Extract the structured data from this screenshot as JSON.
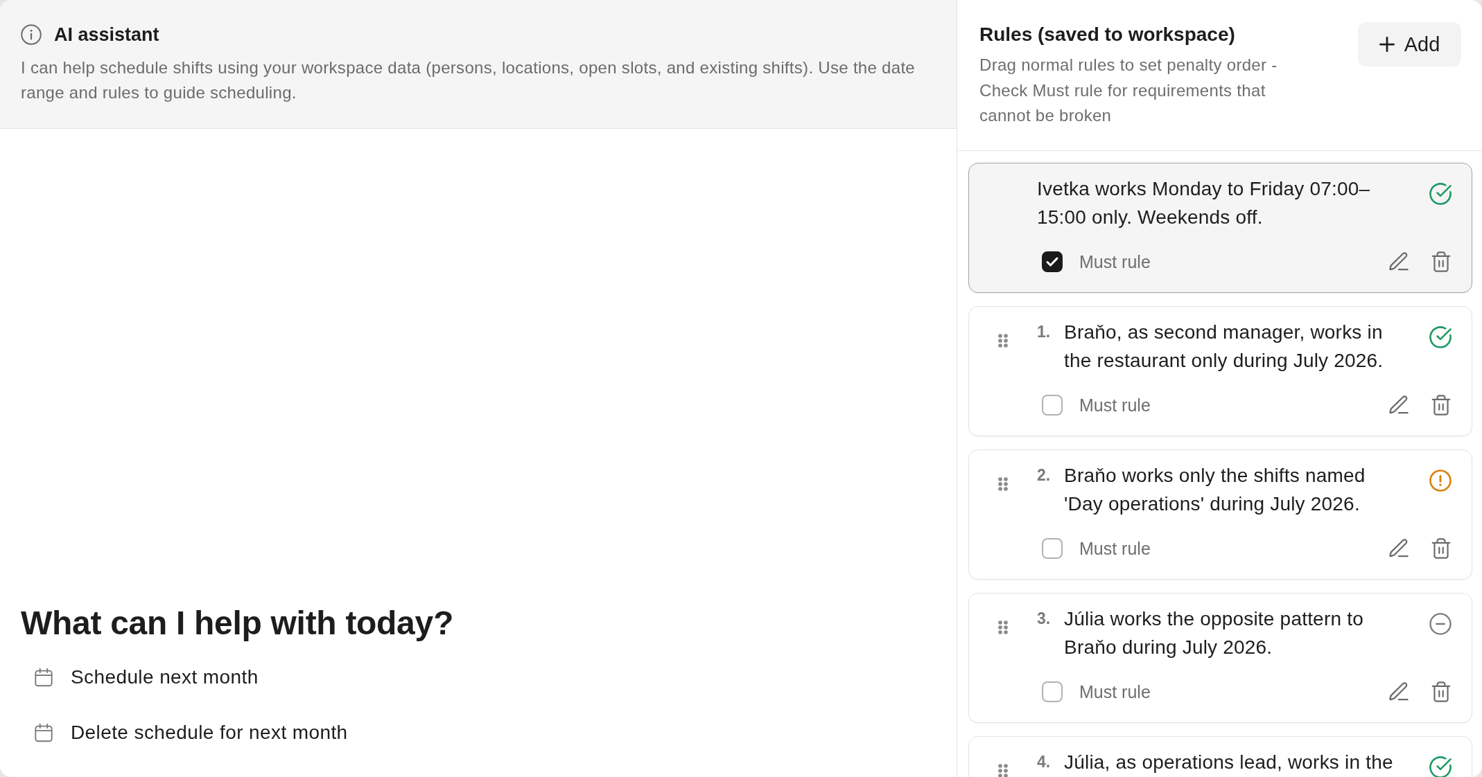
{
  "assistant": {
    "title": "AI assistant",
    "description": "I can help schedule shifts using your workspace data (persons, locations, open slots, and existing shifts). Use the date range and rules to guide scheduling."
  },
  "welcome": {
    "heading": "What can I help with today?",
    "suggestions": [
      {
        "label": "Schedule next month"
      },
      {
        "label": "Delete schedule for next month"
      }
    ]
  },
  "rules_panel": {
    "title": "Rules (saved to workspace)",
    "description": "Drag normal rules to set penalty order - Check Must rule for requirements that cannot be broken",
    "add_button": "Add",
    "rules": [
      {
        "kind": "must",
        "text": "Ivetka works Monday to Friday 07:00–15:00 only. Weekends off.",
        "status": {
          "kind": "check",
          "color": "#1f9a67"
        },
        "must_rule": {
          "label": "Must rule",
          "checked": true
        }
      },
      {
        "kind": "normal",
        "number": "1.",
        "text": "Braňo, as second manager, works in the restaurant only during July 2026.",
        "status": {
          "kind": "check",
          "color": "#1f9a67"
        },
        "must_rule": {
          "label": "Must rule",
          "checked": false
        }
      },
      {
        "kind": "normal",
        "number": "2.",
        "text": "Braňo works only the shifts named 'Day operations' during July 2026.",
        "status": {
          "kind": "exclamation",
          "color": "#d9820f"
        },
        "must_rule": {
          "label": "Must rule",
          "checked": false
        }
      },
      {
        "kind": "normal",
        "number": "3.",
        "text": "Júlia works the opposite pattern to Braňo during July 2026.",
        "status": {
          "kind": "minus",
          "color": "#7a7a7a"
        },
        "must_rule": {
          "label": "Must rule",
          "checked": false
        }
      },
      {
        "kind": "normal",
        "number": "4.",
        "text": "Júlia, as operations lead, works in the",
        "status": {
          "kind": "check",
          "color": "#1f9a67"
        }
      }
    ]
  }
}
